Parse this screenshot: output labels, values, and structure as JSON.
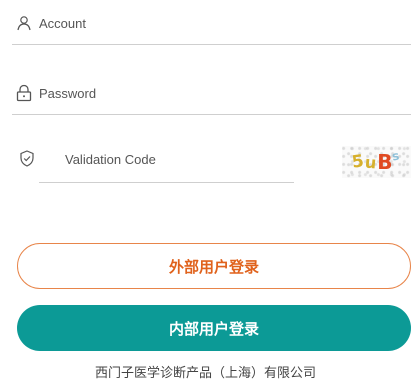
{
  "login_form": {
    "account": {
      "placeholder": "Account",
      "icon": "user-icon"
    },
    "password": {
      "placeholder": "Password",
      "icon": "lock-icon"
    },
    "validation": {
      "placeholder": "Validation Code",
      "icon": "shield-check-icon",
      "captcha_chars": [
        "5",
        "u",
        "B",
        "s"
      ]
    }
  },
  "buttons": {
    "external_login": "外部用户登录",
    "internal_login": "内部用户登录"
  },
  "footer": {
    "company": "西门子医学诊断产品（上海）有限公司"
  },
  "colors": {
    "accent_orange": "#e0621c",
    "accent_teal": "#0c9a96"
  }
}
